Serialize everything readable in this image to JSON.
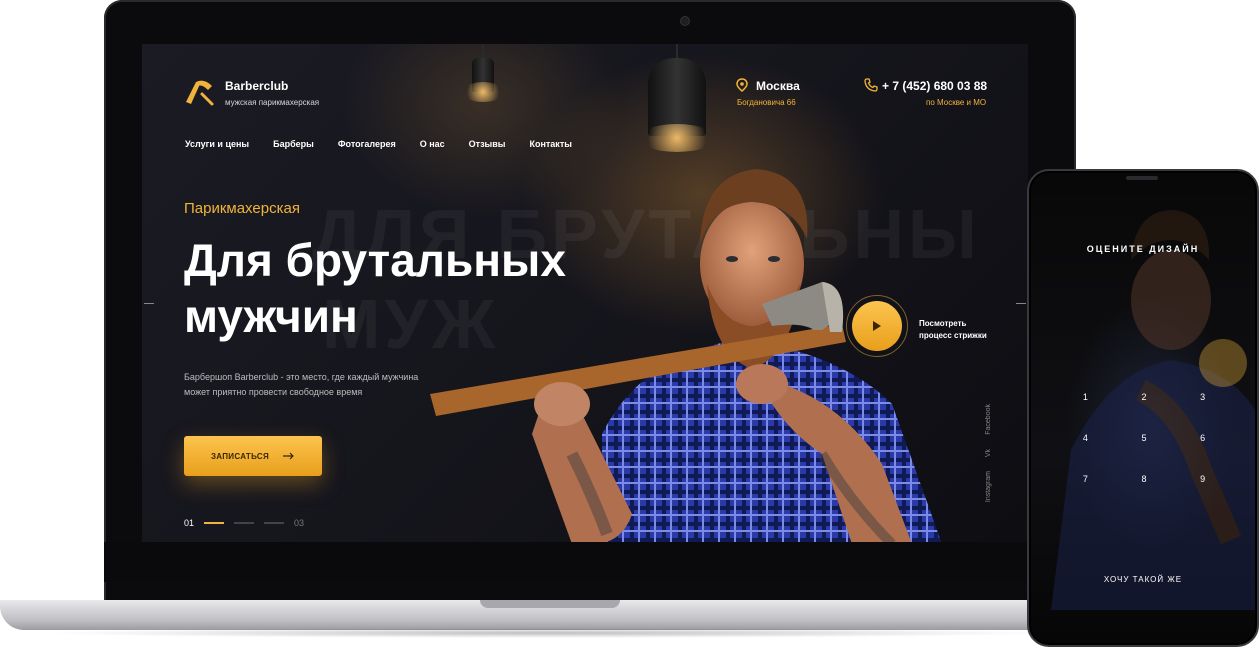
{
  "site": {
    "brand": "Barberclub",
    "brand_sub": "мужская парикмахерская",
    "city": "Москва",
    "address": "Богдановича 66",
    "phone": "+ 7 (452) 680 03 88",
    "phone_sub": "по Москве и МО",
    "nav": [
      "Услуги и цены",
      "Барберы",
      "Фотогалерея",
      "О нас",
      "Отзывы",
      "Контакты"
    ],
    "eyebrow": "Парикмахерская",
    "headline": "Для брутальных мужчин",
    "description": "Барбершоп Barberclub - это место, где каждый мужчина  может приятно провести свободное время",
    "cta_label": "ЗАПИСАТЬСЯ",
    "pager": {
      "current": "01",
      "last": "03"
    },
    "video_label": "Посмотреть процесс стрижки",
    "social": [
      "Facebook",
      "Vk",
      "Instagram"
    ],
    "bg_word": "ДЛЯ БРУТАЛЬНЫ",
    "bg_word2": "МУЖ"
  },
  "mobile": {
    "title": "ОЦЕНИТЕ ДИЗАЙН",
    "digits": [
      "1",
      "2",
      "3",
      "4",
      "5",
      "6",
      "7",
      "8",
      "9"
    ],
    "bottom": "ХОЧУ ТАКОЙ ЖЕ"
  },
  "icons": {
    "logo": "razor-icon",
    "location": "pin-icon",
    "phone": "phone-icon",
    "cta_arrow": "arrow-right-icon",
    "play": "play-icon"
  },
  "colors": {
    "accent": "#f0b43a",
    "background": "#15151c",
    "shirt": "#2a3aa8"
  }
}
